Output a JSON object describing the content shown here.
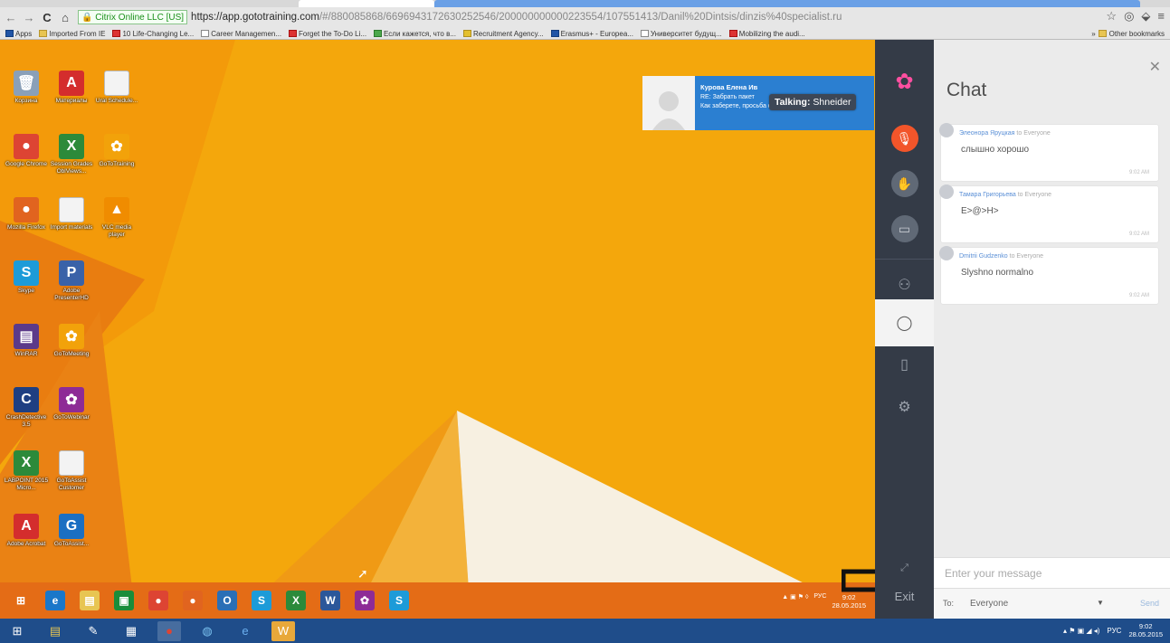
{
  "browser": {
    "ssl_label": "Citrix Online LLC [US]",
    "url_main": "https://app.gototraining.com",
    "url_rest": "/#/880085868/6696943172630252546/200000000000223554/107551413/Danil%20Dintsis/dinzis%40specialist.ru",
    "bookmarks": [
      {
        "label": "Apps",
        "icon": "apps-icon"
      },
      {
        "label": "Imported From IE",
        "icon": "folder-icon"
      },
      {
        "label": "10 Life-Changing Le...",
        "icon": "red-square-icon"
      },
      {
        "label": "Career Managemen...",
        "icon": "doc-icon"
      },
      {
        "label": "Forget the To-Do Li...",
        "icon": "red-square-icon"
      },
      {
        "label": "Если кажется, что в...",
        "icon": "grn-icon"
      },
      {
        "label": "Recruitment Agency...",
        "icon": "yel-icon"
      },
      {
        "label": "Erasmus+ - Europea...",
        "icon": "blue-icon"
      },
      {
        "label": "Университет будущ...",
        "icon": "doc-icon"
      },
      {
        "label": "Mobilizing the audi...",
        "icon": "red-square-icon"
      }
    ],
    "other_bookmarks": "Other bookmarks"
  },
  "desktop": {
    "icons": [
      {
        "label": "Корзина",
        "color": "#8aa0b8",
        "glyph": "🗑"
      },
      {
        "label": "Материалы",
        "color": "#d42d2d",
        "glyph": "A"
      },
      {
        "label": "Ural Schedule...",
        "color": "#f3f3f3",
        "glyph": ""
      },
      {
        "label": "Google Chrome",
        "color": "#dd4433",
        "glyph": "●"
      },
      {
        "label": "Session Grades OblViews...",
        "color": "#2c8a3a",
        "glyph": "X"
      },
      {
        "label": "GoToTraining",
        "color": "#f2a20a",
        "glyph": "✿"
      },
      {
        "label": "Mozilla Firefox",
        "color": "#e1641f",
        "glyph": "●"
      },
      {
        "label": "Import materials",
        "color": "#f3f3f3",
        "glyph": ""
      },
      {
        "label": "VLC media player",
        "color": "#f08c00",
        "glyph": "▲"
      },
      {
        "label": "Skype",
        "color": "#1d9bd8",
        "glyph": "S"
      },
      {
        "label": "Adobe PresenterHD",
        "color": "#3a62a8",
        "glyph": "P"
      },
      {
        "label": "WinRAR",
        "color": "#5b3a8a",
        "glyph": "▤"
      },
      {
        "label": "GoToMeeting",
        "color": "#f2a20a",
        "glyph": "✿"
      },
      {
        "label": "CrashDetective 3.5",
        "color": "#1f3f82",
        "glyph": "C"
      },
      {
        "label": "GoToWebinar",
        "color": "#8e2b96",
        "glyph": "✿"
      },
      {
        "label": "LABPOINT 2015 Micro...",
        "color": "#2c8a3a",
        "glyph": "X"
      },
      {
        "label": "GoToAssist Customer",
        "color": "#f3f3f3",
        "glyph": ""
      },
      {
        "label": "Adobe Acrobat",
        "color": "#d42d2d",
        "glyph": "A"
      },
      {
        "label": "GoToAssist...",
        "color": "#1b6fc2",
        "glyph": "G"
      }
    ],
    "talking_prefix": "Talking:",
    "talking_name": "Shneider",
    "video_name": "Курова Елена Ив",
    "video_line1": "RE: Забрать пакет",
    "video_line2": "Как заберете, просьба сразу м...",
    "inner_clock_time": "9:02",
    "inner_clock_date": "28.05.2015",
    "inner_lang": "РУС"
  },
  "rail": {
    "exit_label": "Exit",
    "accent": "#f2552a"
  },
  "chat": {
    "title": "Chat",
    "messages": [
      {
        "sender": "Элеонора Яруцкая",
        "to": "to Everyone",
        "text": "слышно хорошо",
        "time": "9:02 AM"
      },
      {
        "sender": "Тамара Григорьева",
        "to": "to Everyone",
        "text": "E>@>H>",
        "time": "9:02 AM"
      },
      {
        "sender": "Dmitrii Gudzenko",
        "to": "to Everyone",
        "text": "Slyshno normalno",
        "time": "9:02 AM"
      }
    ],
    "input_placeholder": "Enter your message",
    "to_label": "To:",
    "to_value": "Everyone",
    "send_label": "Send"
  },
  "ostaskbar": {
    "lang": "РУС",
    "time": "9:02",
    "date": "28.05.2015"
  }
}
